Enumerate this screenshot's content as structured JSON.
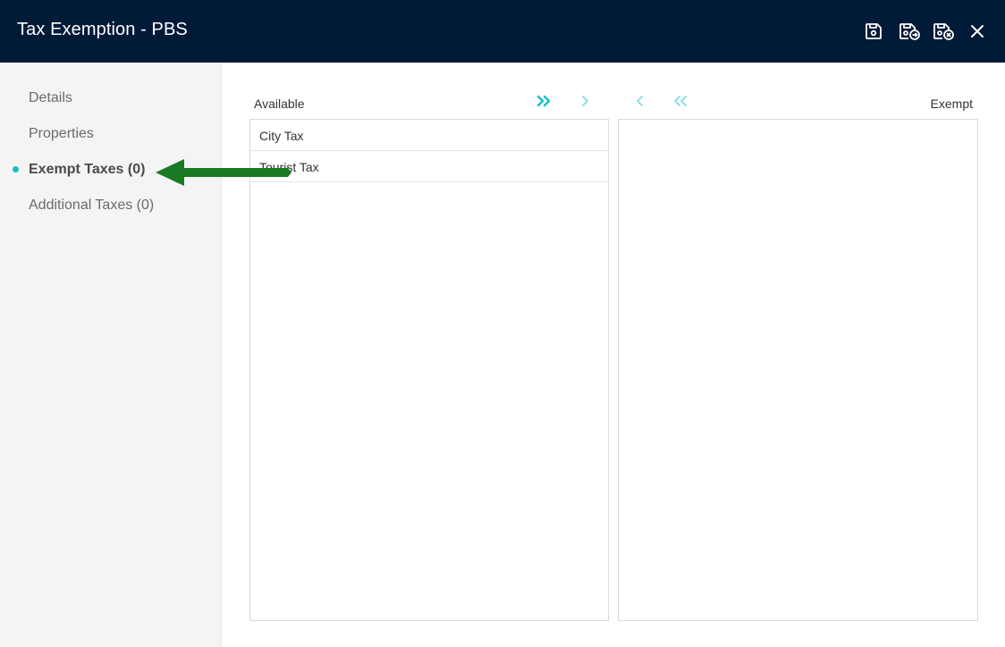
{
  "header": {
    "title": "Tax Exemption - PBS",
    "actions": [
      {
        "icon": "save-icon"
      },
      {
        "icon": "save-and-next-icon"
      },
      {
        "icon": "save-and-close-icon"
      },
      {
        "icon": "close-icon"
      }
    ]
  },
  "sidebar": {
    "items": [
      {
        "label": "Details"
      },
      {
        "label": "Properties"
      },
      {
        "label": "Exempt Taxes (0)",
        "active": true
      },
      {
        "label": "Additional Taxes (0)"
      }
    ]
  },
  "available": {
    "label": "Available",
    "items": [
      "City Tax",
      "Tourist Tax"
    ]
  },
  "exempt": {
    "label": "Exempt",
    "items": []
  },
  "colors": {
    "header_bg": "#011a38",
    "accent": "#13c1c8",
    "accent_disabled": "#8fe0e4",
    "annotation_arrow": "#1a7a22"
  }
}
